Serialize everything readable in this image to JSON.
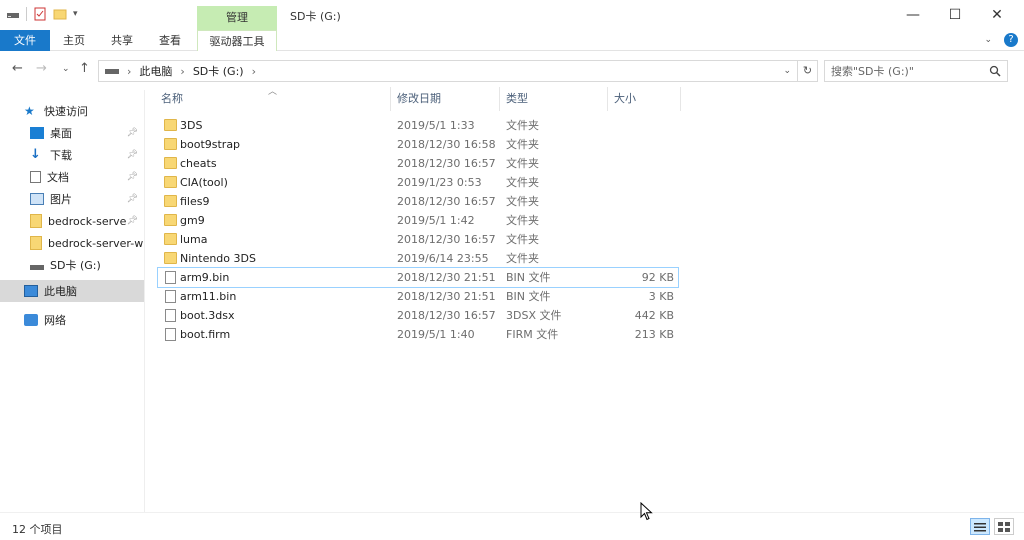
{
  "title_bar": {
    "manage_tab": "管理",
    "window_title": "SD卡 (G:)",
    "minimize": "—",
    "maximize": "☐",
    "close": "✕"
  },
  "ribbon": {
    "tabs": [
      "文件",
      "主页",
      "共享",
      "查看",
      "驱动器工具"
    ]
  },
  "address": {
    "crumbs": [
      "此电脑",
      "SD卡 (G:)"
    ],
    "search_placeholder": "搜索\"SD卡 (G:)\""
  },
  "nav": {
    "items": [
      {
        "label": "快速访问",
        "icon": "star-icon"
      },
      {
        "label": "桌面",
        "icon": "desktop-icon",
        "pinned": true
      },
      {
        "label": "下载",
        "icon": "download-icon",
        "pinned": true
      },
      {
        "label": "文档",
        "icon": "document-icon",
        "pinned": true
      },
      {
        "label": "图片",
        "icon": "picture-icon",
        "pinned": true
      },
      {
        "label": "bedrock-server",
        "icon": "folder-icon",
        "pinned": true
      },
      {
        "label": "bedrock-server-w",
        "icon": "folder-icon"
      },
      {
        "label": "SD卡 (G:)",
        "icon": "drive-icon"
      },
      {
        "label": "此电脑",
        "icon": "computer-icon",
        "selected": true
      },
      {
        "label": "网络",
        "icon": "network-icon"
      }
    ]
  },
  "columns": {
    "name": "名称",
    "date": "修改日期",
    "type": "类型",
    "size": "大小"
  },
  "files": [
    {
      "name": "3DS",
      "date": "2019/5/1 1:33",
      "type": "文件夹",
      "size": "",
      "kind": "folder"
    },
    {
      "name": "boot9strap",
      "date": "2018/12/30 16:58",
      "type": "文件夹",
      "size": "",
      "kind": "folder"
    },
    {
      "name": "cheats",
      "date": "2018/12/30 16:57",
      "type": "文件夹",
      "size": "",
      "kind": "folder"
    },
    {
      "name": "CIA(tool)",
      "date": "2019/1/23 0:53",
      "type": "文件夹",
      "size": "",
      "kind": "folder"
    },
    {
      "name": "files9",
      "date": "2018/12/30 16:57",
      "type": "文件夹",
      "size": "",
      "kind": "folder"
    },
    {
      "name": "gm9",
      "date": "2019/5/1 1:42",
      "type": "文件夹",
      "size": "",
      "kind": "folder"
    },
    {
      "name": "luma",
      "date": "2018/12/30 16:57",
      "type": "文件夹",
      "size": "",
      "kind": "folder"
    },
    {
      "name": "Nintendo 3DS",
      "date": "2019/6/14 23:55",
      "type": "文件夹",
      "size": "",
      "kind": "folder"
    },
    {
      "name": "arm9.bin",
      "date": "2018/12/30 21:51",
      "type": "BIN 文件",
      "size": "92 KB",
      "kind": "file",
      "focused": true
    },
    {
      "name": "arm11.bin",
      "date": "2018/12/30 21:51",
      "type": "BIN 文件",
      "size": "3 KB",
      "kind": "file"
    },
    {
      "name": "boot.3dsx",
      "date": "2018/12/30 16:57",
      "type": "3DSX 文件",
      "size": "442 KB",
      "kind": "file"
    },
    {
      "name": "boot.firm",
      "date": "2019/5/1 1:40",
      "type": "FIRM 文件",
      "size": "213 KB",
      "kind": "file"
    }
  ],
  "status": {
    "count": "12 个项目"
  },
  "colors": {
    "file_tab": "#1979ca",
    "manage_tab": "#c6ecb3",
    "folder": "#f8d774",
    "header_text": "#4c607a"
  }
}
